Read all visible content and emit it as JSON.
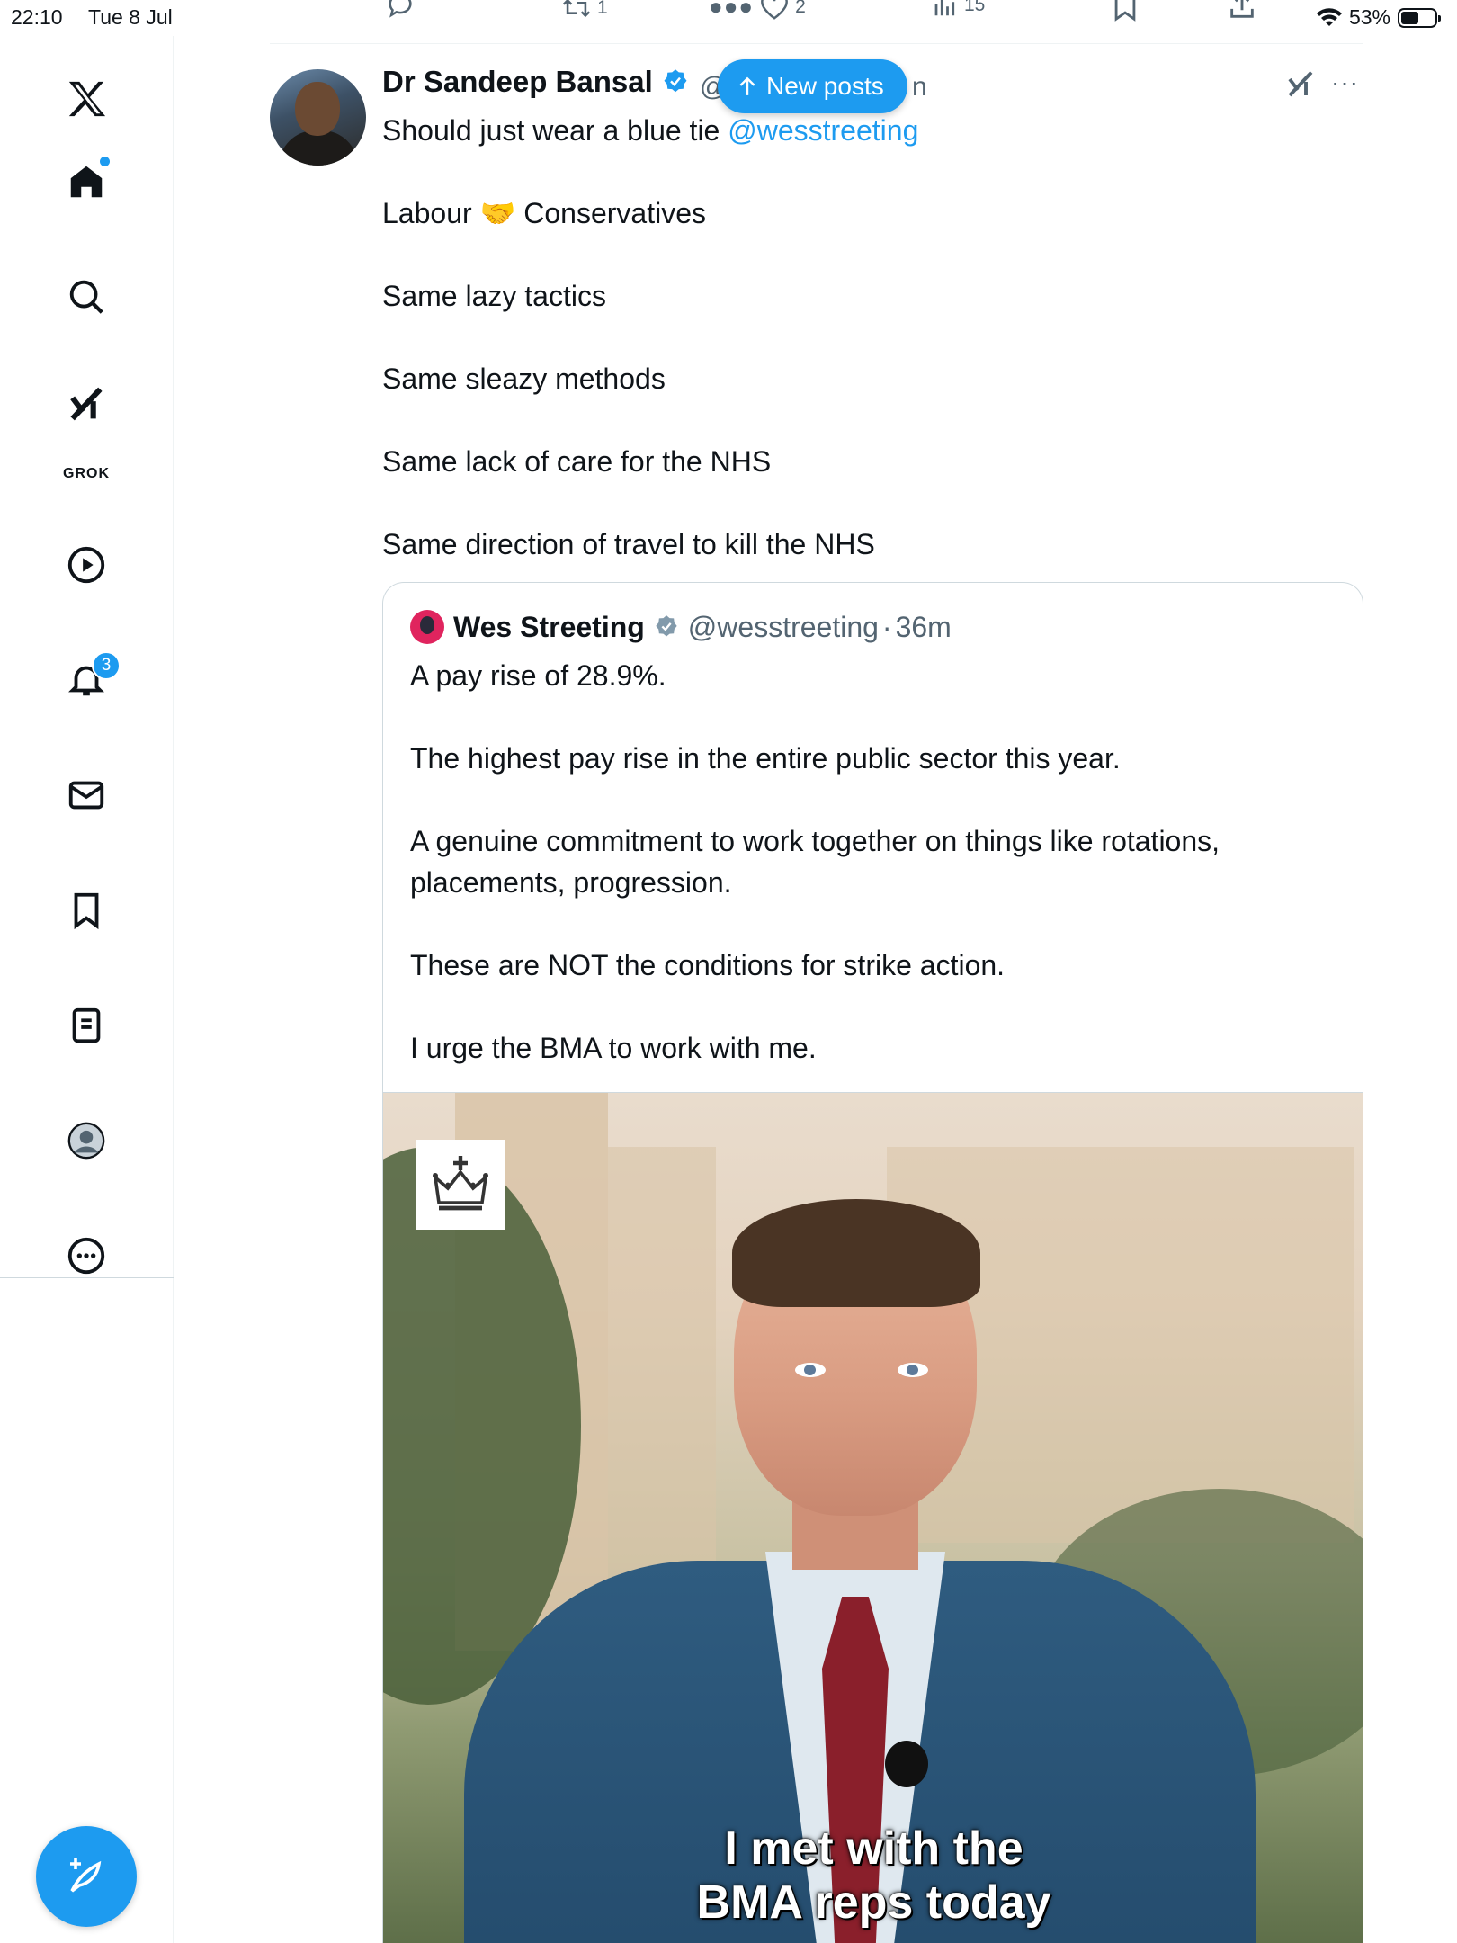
{
  "status_bar": {
    "time": "22:10",
    "date": "Tue 8 Jul",
    "battery": "53%",
    "battery_level": 0.53
  },
  "sidebar": {
    "grok_label": "GROK",
    "notifications_count": "3",
    "items": [
      "x-logo",
      "home",
      "search",
      "grok",
      "videos",
      "notifications",
      "messages",
      "bookmarks",
      "lists",
      "profile",
      "more"
    ]
  },
  "prev_actions": {
    "retweets": "1",
    "likes": "2",
    "views": "15"
  },
  "post": {
    "author_name": "Dr Sandeep Bansal",
    "handle_start": "@",
    "handle_end": "n",
    "new_posts_label": "New posts",
    "lines": {
      "l1": "Should just wear a blue tie ",
      "l1_mention": "@wesstreeting",
      "l2a": "Labour ",
      "l2_emoji": "🤝",
      "l2b": " Conservatives",
      "l3": "Same lazy tactics",
      "l4": "Same sleazy methods",
      "l5": "Same lack of care for the NHS",
      "l6": "Same direction of travel to kill the NHS"
    }
  },
  "quote": {
    "name": "Wes Streeting",
    "handle": "@wesstreeting",
    "separator": "·",
    "time": "36m",
    "lines": {
      "l1": "A pay rise of 28.9%.",
      "l2": "The highest pay rise in the entire public sector this year.",
      "l3": "A genuine commitment to work together on things like rotations, placements, progression.",
      "l4": "These are NOT the conditions for strike action.",
      "l5": "I urge the BMA to work with me."
    },
    "video_caption_1": "I met with the",
    "video_caption_2": "BMA reps today"
  },
  "colors": {
    "accent": "#1d9bf0",
    "text": "#0f1419",
    "muted": "#536471",
    "border": "#cfd9de"
  }
}
